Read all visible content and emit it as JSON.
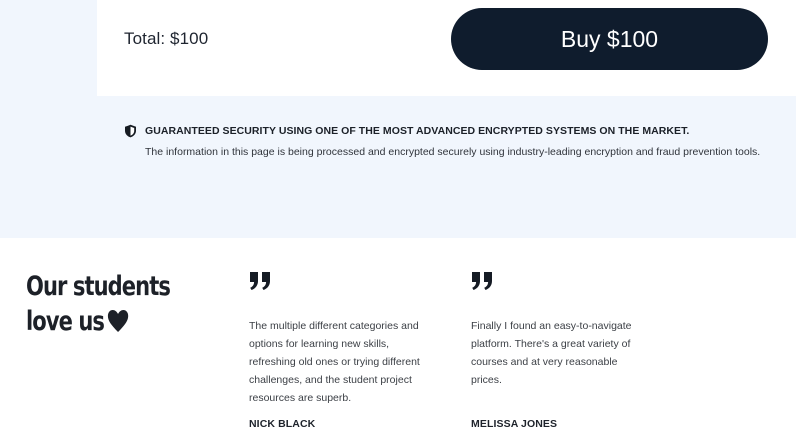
{
  "checkout": {
    "total_label": "Total: $100",
    "buy_button_label": "Buy $100"
  },
  "security": {
    "icon": "shield-icon",
    "heading": "GUARANTEED SECURITY USING ONE OF THE MOST ADVANCED ENCRYPTED SYSTEMS ON THE MARKET.",
    "description": "The information in this page is being processed and encrypted securely using industry-leading encryption and fraud prevention tools."
  },
  "testimonials": {
    "title": "Our students\nlove us",
    "title_icon": "heart-icon",
    "items": [
      {
        "quote_mark": "❞❞",
        "text": "The multiple different categories and options for learning new skills, refreshing old ones or trying different challenges, and the student project resources are superb.",
        "author": "NICK BLACK"
      },
      {
        "quote_mark": "❞❞",
        "text": "Finally I found an easy-to-navigate platform. There's a great variety of courses and at very reasonable prices.",
        "author": "MELISSA JONES"
      }
    ]
  },
  "colors": {
    "page_background": "#f1f6fd",
    "card_background": "#ffffff",
    "button_background": "#0f1c2d",
    "button_text": "#ffffff",
    "text_primary": "#1b2028"
  }
}
